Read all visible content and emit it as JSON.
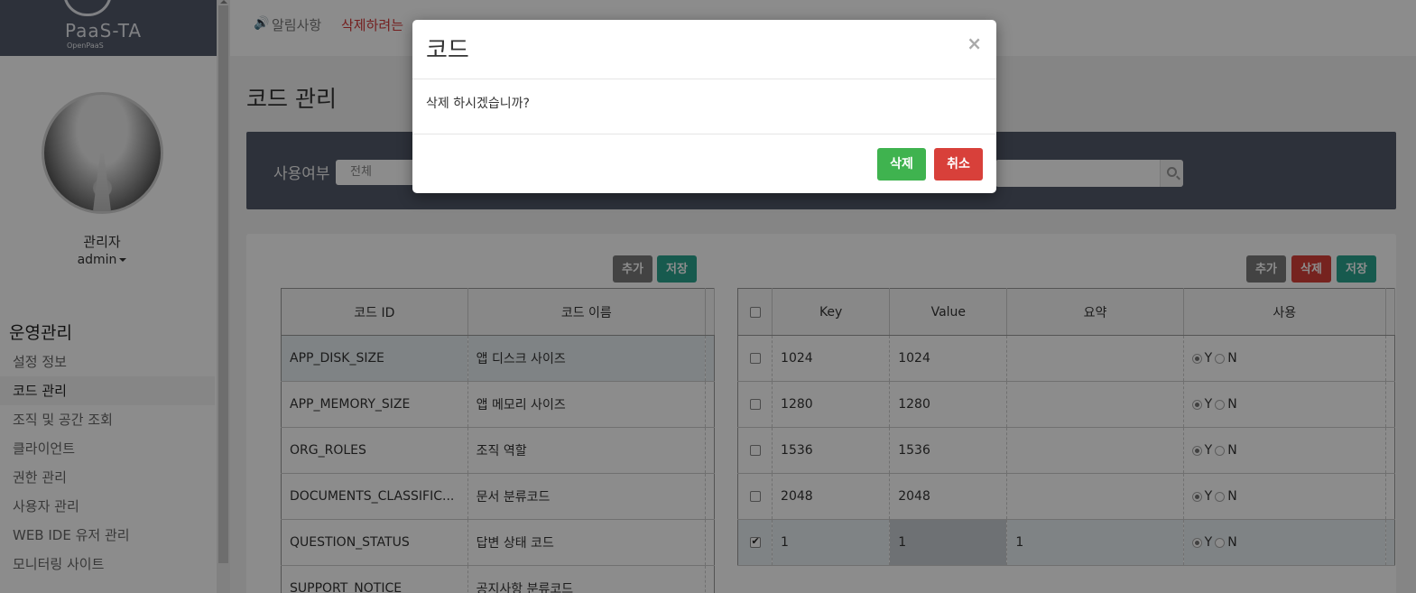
{
  "sidebar": {
    "logo_text": "PaaS-TA",
    "logo_sub": "OpenPaaS",
    "user_role": "관리자",
    "user_id": "admin",
    "menu_title": "운영관리",
    "menu_items": [
      {
        "label": "설정 정보"
      },
      {
        "label": "코드 관리",
        "active": true
      },
      {
        "label": "조직 및 공간 조회"
      },
      {
        "label": "클라이언트"
      },
      {
        "label": "권한 관리"
      },
      {
        "label": "사용자 관리"
      },
      {
        "label": "WEB IDE 유저 관리"
      },
      {
        "label": "모니터링 사이트"
      }
    ]
  },
  "notice": {
    "label": "알림사항",
    "text": "삭제하려는"
  },
  "page": {
    "title": "코드 관리"
  },
  "search": {
    "label": "사용여부",
    "select_value": "전체"
  },
  "left_table": {
    "add_label": "추가",
    "save_label": "저장",
    "headers": [
      "코드 ID",
      "코드 이름"
    ],
    "rows": [
      [
        "APP_DISK_SIZE",
        "앱 디스크 사이즈"
      ],
      [
        "APP_MEMORY_SIZE",
        "앱 메모리 사이즈"
      ],
      [
        "ORG_ROLES",
        "조직 역할"
      ],
      [
        "DOCUMENTS_CLASSIFIC...",
        "문서 분류코드"
      ],
      [
        "QUESTION_STATUS",
        "답변 상태 코드"
      ],
      [
        "SUPPORT_NOTICE",
        "공지사항 분류코드"
      ]
    ]
  },
  "right_table": {
    "add_label": "추가",
    "delete_label": "삭제",
    "save_label": "저장",
    "headers": [
      "Key",
      "Value",
      "요약",
      "사용"
    ],
    "radio_yes": "Y",
    "radio_no": "N",
    "rows": [
      {
        "checked": false,
        "key": "1024",
        "value": "1024",
        "summary": ""
      },
      {
        "checked": false,
        "key": "1280",
        "value": "1280",
        "summary": ""
      },
      {
        "checked": false,
        "key": "1536",
        "value": "1536",
        "summary": ""
      },
      {
        "checked": false,
        "key": "2048",
        "value": "2048",
        "summary": ""
      },
      {
        "checked": true,
        "key": "1",
        "value": "1",
        "summary": "1"
      }
    ]
  },
  "modal": {
    "title": "코드",
    "close": "×",
    "message": "삭제 하시겠습니까?",
    "confirm_label": "삭제",
    "cancel_label": "취소"
  },
  "colors": {
    "sidebar_logo_bg": "#525a6b",
    "search_panel_bg": "#525a6b",
    "btn_green": "#3fb34f",
    "btn_red": "#d8403a",
    "btn_teal": "#2aa58f",
    "notice_text": "#d43a3a"
  }
}
